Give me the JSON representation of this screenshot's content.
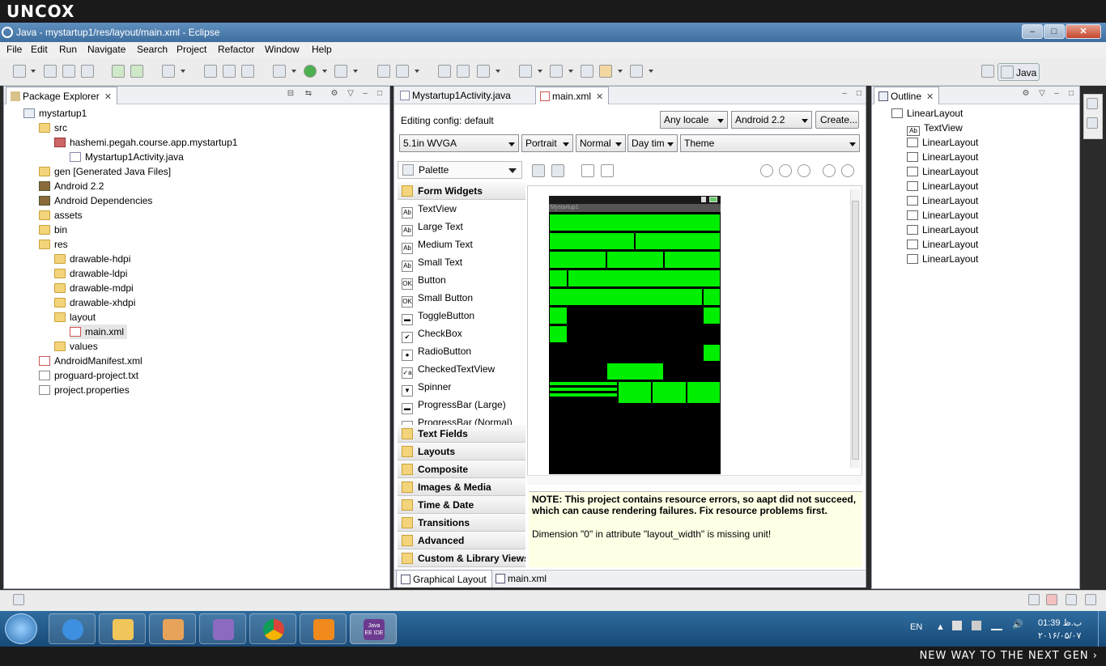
{
  "overlay": {
    "brand": "UNCOX",
    "slogan": "NEW WAY TO THE NEXT GEN ›"
  },
  "window": {
    "title": "Java - mystartup1/res/layout/main.xml - Eclipse",
    "minimize": "–",
    "maximize": "□",
    "close": "✕"
  },
  "menu": [
    "File",
    "Edit",
    "Run",
    "Navigate",
    "Search",
    "Project",
    "Refactor",
    "Window",
    "Help"
  ],
  "perspective": {
    "label": "Java"
  },
  "package_explorer": {
    "tab_label": "Package Explorer",
    "tree": [
      {
        "label": "mystartup1",
        "icon": "project-icon",
        "depth": 0
      },
      {
        "label": "src",
        "icon": "source-folder-icon",
        "depth": 1
      },
      {
        "label": "hashemi.pegah.course.app.mystartup1",
        "icon": "package-icon",
        "depth": 2
      },
      {
        "label": "Mystartup1Activity.java",
        "icon": "java-file-icon",
        "depth": 3
      },
      {
        "label": "gen [Generated Java Files]",
        "icon": "source-folder-icon",
        "depth": 1
      },
      {
        "label": "Android 2.2",
        "icon": "library-icon",
        "depth": 1
      },
      {
        "label": "Android Dependencies",
        "icon": "library-icon",
        "depth": 1
      },
      {
        "label": "assets",
        "icon": "folder-icon",
        "depth": 1
      },
      {
        "label": "bin",
        "icon": "folder-icon",
        "depth": 1
      },
      {
        "label": "res",
        "icon": "folder-icon",
        "depth": 1
      },
      {
        "label": "drawable-hdpi",
        "icon": "folder-icon",
        "depth": 2
      },
      {
        "label": "drawable-ldpi",
        "icon": "folder-icon",
        "depth": 2
      },
      {
        "label": "drawable-mdpi",
        "icon": "folder-icon",
        "depth": 2
      },
      {
        "label": "drawable-xhdpi",
        "icon": "folder-icon",
        "depth": 2
      },
      {
        "label": "layout",
        "icon": "folder-icon",
        "depth": 2
      },
      {
        "label": "main.xml",
        "icon": "xml-file-icon",
        "depth": 3
      },
      {
        "label": "values",
        "icon": "folder-icon",
        "depth": 2
      },
      {
        "label": "AndroidManifest.xml",
        "icon": "xml-file-icon",
        "depth": 1
      },
      {
        "label": "proguard-project.txt",
        "icon": "text-file-icon",
        "depth": 1
      },
      {
        "label": "project.properties",
        "icon": "text-file-icon",
        "depth": 1
      }
    ]
  },
  "editor": {
    "tabs": [
      {
        "label": "Mystartup1Activity.java",
        "active": false
      },
      {
        "label": "main.xml",
        "active": true
      }
    ],
    "config_label": "Editing config:  default",
    "locale": "Any locale",
    "target": "Android 2.2",
    "create_button": "Create...",
    "device": "5.1in WVGA",
    "orientation": "Portrait",
    "dock_mode": "Normal",
    "night_mode": "Day tim",
    "theme": "Theme",
    "palette_label": "Palette",
    "palette_category_open": "Form Widgets",
    "palette_items": [
      {
        "label": "TextView",
        "icon": "Ab"
      },
      {
        "label": "Large Text",
        "icon": "Ab"
      },
      {
        "label": "Medium Text",
        "icon": "Ab"
      },
      {
        "label": "Small Text",
        "icon": "Ab"
      },
      {
        "label": "Button",
        "icon": "OK"
      },
      {
        "label": "Small Button",
        "icon": "OK"
      },
      {
        "label": "ToggleButton",
        "icon": "▬"
      },
      {
        "label": "CheckBox",
        "icon": "✔"
      },
      {
        "label": "RadioButton",
        "icon": "●"
      },
      {
        "label": "CheckedTextView",
        "icon": "✓a"
      },
      {
        "label": "Spinner",
        "icon": "▼"
      },
      {
        "label": "ProgressBar (Large)",
        "icon": "▬"
      },
      {
        "label": "ProgressBar (Normal)",
        "icon": "▬"
      }
    ],
    "palette_categories": [
      "Text Fields",
      "Layouts",
      "Composite",
      "Images & Media",
      "Time & Date",
      "Transitions",
      "Advanced",
      "Custom & Library Views"
    ],
    "preview_app_title": "Mystartup1",
    "note_line1": "NOTE: This project contains resource errors, so aapt did not succeed,",
    "note_line2": "which can cause rendering failures. Fix resource problems first.",
    "error_message": "Dimension \"0\" in attribute \"layout_width\" is missing unit!",
    "bottom_tabs": [
      "Graphical Layout",
      "main.xml"
    ]
  },
  "outline": {
    "tab_label": "Outline",
    "root": "LinearLayout",
    "children": [
      "TextView",
      "LinearLayout",
      "LinearLayout",
      "LinearLayout",
      "LinearLayout",
      "LinearLayout",
      "LinearLayout",
      "LinearLayout",
      "LinearLayout",
      "LinearLayout"
    ]
  },
  "taskbar": {
    "language": "EN",
    "time": "01:39 ب.ظ",
    "date": "۲۰۱۶/۰۵/۰۷",
    "apps": [
      "Internet Explorer",
      "Windows Explorer",
      "Media Player",
      "Visual Studio",
      "Chrome",
      "VLC",
      "Java EE IDE"
    ],
    "eclipse_badge": "Java EE IDE"
  },
  "colors": {
    "preview_green": "#00ee00",
    "titlebar": "#4f7faf",
    "taskbar": "#1f5a8a"
  }
}
